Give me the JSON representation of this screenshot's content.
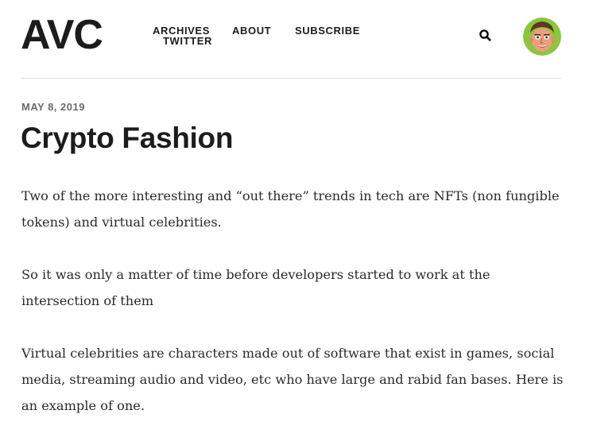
{
  "site": {
    "logo": "AVC"
  },
  "nav": {
    "archives": "ARCHIVES",
    "twitter": "TWITTER",
    "about": "ABOUT",
    "subscribe": "SUBSCRIBE"
  },
  "header": {
    "search_icon": "search-icon",
    "avatar_icon": "avatar-illustrated-face"
  },
  "post": {
    "date": "MAY 8, 2019",
    "title": "Crypto Fashion",
    "paragraphs": [
      "Two of the more interesting and “out there” trends in tech are NFTs (non fungible tokens) and virtual celebrities.",
      "So it was only a matter of time before developers started to work at the intersection of them",
      "Virtual celebrities are characters made out of software that exist in games, social media, streaming audio and video, etc who have large and rabid fan bases. Here is an example of one."
    ]
  },
  "colors": {
    "text": "#1c1c1c",
    "date": "#6b6b6b",
    "rule": "#dddddd",
    "avatar_bg": "#8cc63f"
  }
}
